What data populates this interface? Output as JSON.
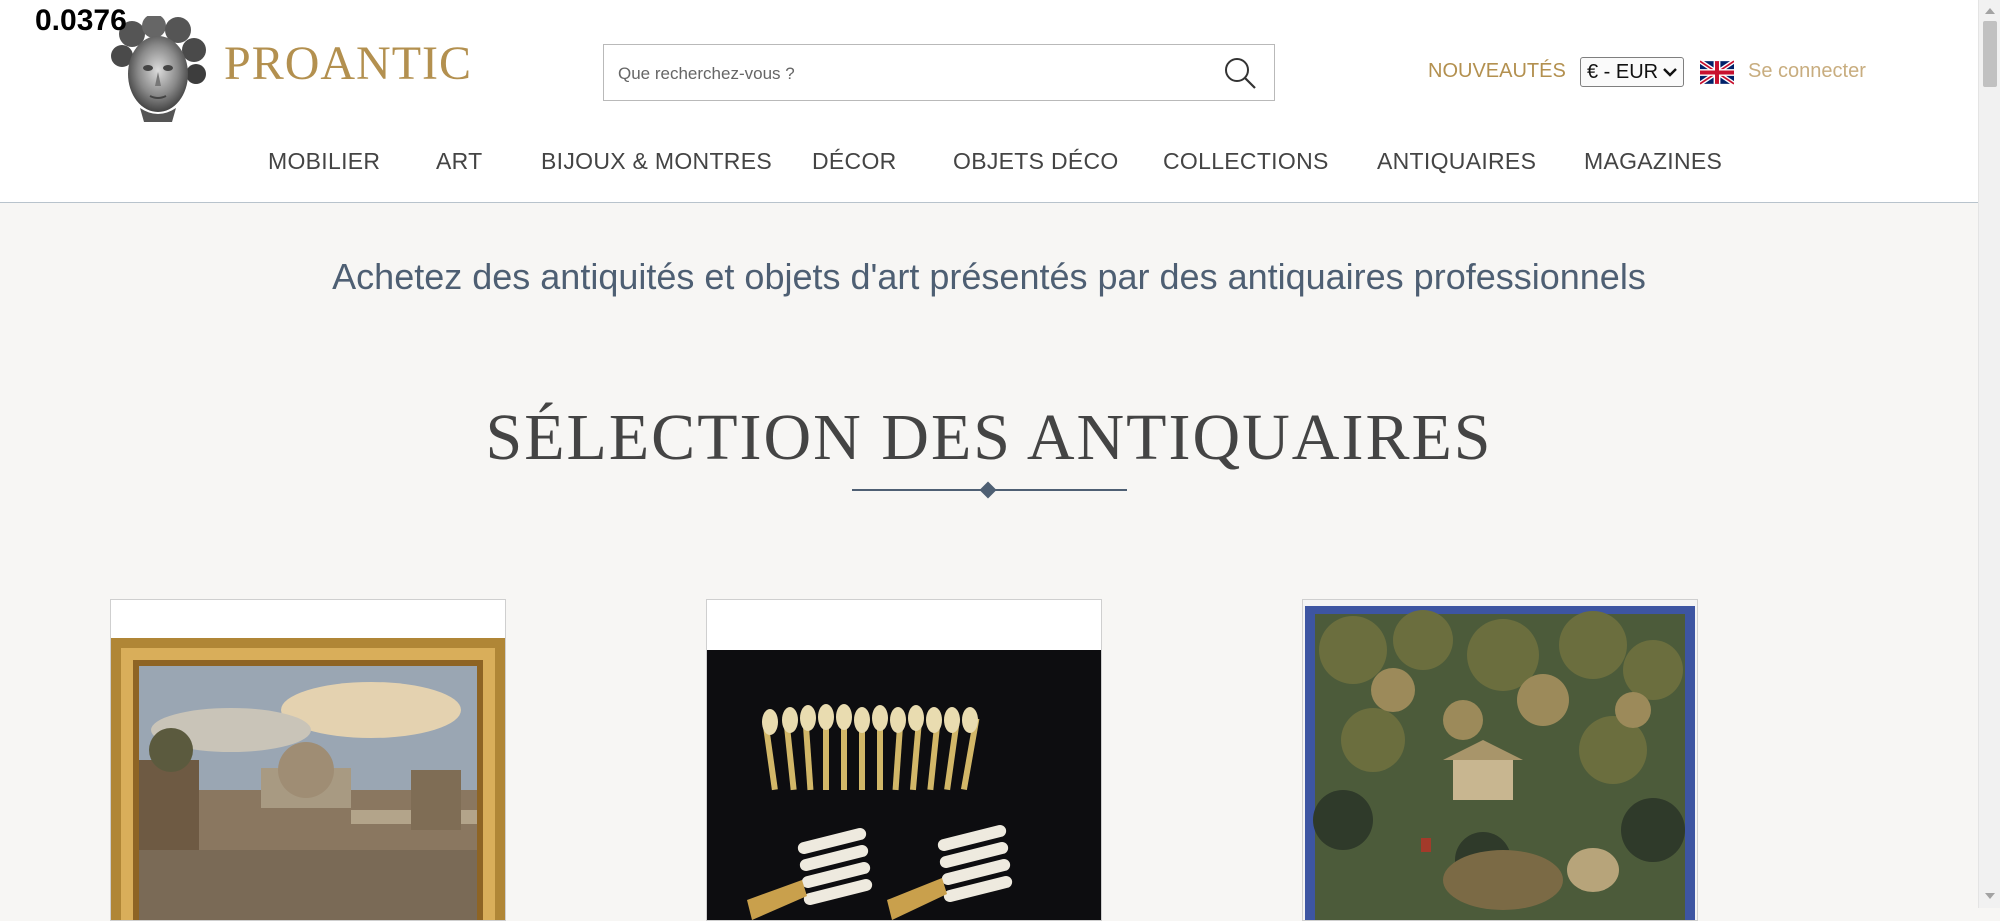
{
  "overlay_number": "0.0376",
  "header": {
    "logo_text": "PROANTIC",
    "search_placeholder": "Que recherchez-vous ?",
    "nouveautes": "NOUVEAUTÉS",
    "currency": "€ - EUR",
    "login": "Se connecter"
  },
  "nav": {
    "items": [
      "MOBILIER",
      "ART",
      "BIJOUX & MONTRES",
      "DÉCOR",
      "OBJETS DÉCO",
      "COLLECTIONS",
      "ANTIQUAIRES",
      "MAGAZINES"
    ]
  },
  "main": {
    "tagline": "Achetez des antiquités et objets d'art présentés par des antiquaires professionnels",
    "section_title": "SÉLECTION DES ANTIQUAIRES"
  },
  "colors": {
    "brand_gold": "#b3904f",
    "accent_slate": "#4e5f73",
    "background": "#f7f6f4"
  }
}
